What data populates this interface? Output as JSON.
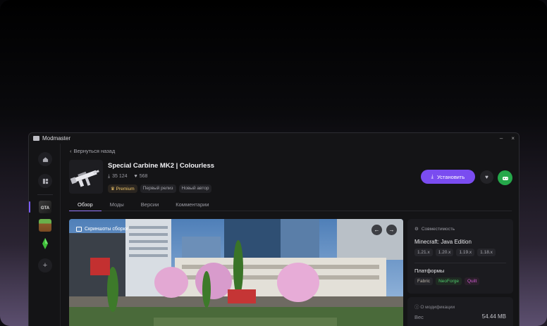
{
  "app": {
    "title": "Modmaster",
    "minimize": "–",
    "close": "×"
  },
  "sidebar": {
    "home_icon": "home-icon",
    "library_icon": "library-icon",
    "games": [
      "gta-v",
      "minecraft",
      "sims"
    ],
    "add_label": "+"
  },
  "nav": {
    "back_label": "Вернуться назад"
  },
  "modpack": {
    "title": "Special Carbine MK2 | Colourless",
    "downloads": "35 124",
    "likes": "568",
    "tags": [
      {
        "label": "Premium",
        "kind": "premium"
      },
      {
        "label": "Первый релиз",
        "kind": "normal"
      },
      {
        "label": "Новый автор",
        "kind": "normal"
      }
    ]
  },
  "actions": {
    "install_label": "Установить"
  },
  "tabs": [
    {
      "label": "Обзор",
      "active": true
    },
    {
      "label": "Моды",
      "active": false
    },
    {
      "label": "Версии",
      "active": false
    },
    {
      "label": "Комментарии",
      "active": false
    }
  ],
  "gallery": {
    "label": "Скриншоты сборки",
    "prev": "←",
    "next": "→"
  },
  "compat": {
    "heading": "Совместимость",
    "game_title": "Minecraft: Java Edition",
    "versions": [
      "1.21.x",
      "1.20.x",
      "1.19.x",
      "1.18.x"
    ],
    "platforms_heading": "Платформы",
    "platforms": [
      "Fabric",
      "NeoForge",
      "Quilt"
    ]
  },
  "about": {
    "heading": "О модификации",
    "weight_label": "Вес",
    "weight_value": "54.44 MB"
  },
  "colors": {
    "accent": "#7a4cf0",
    "success": "#25a84a",
    "premium": "#f2c86a"
  }
}
